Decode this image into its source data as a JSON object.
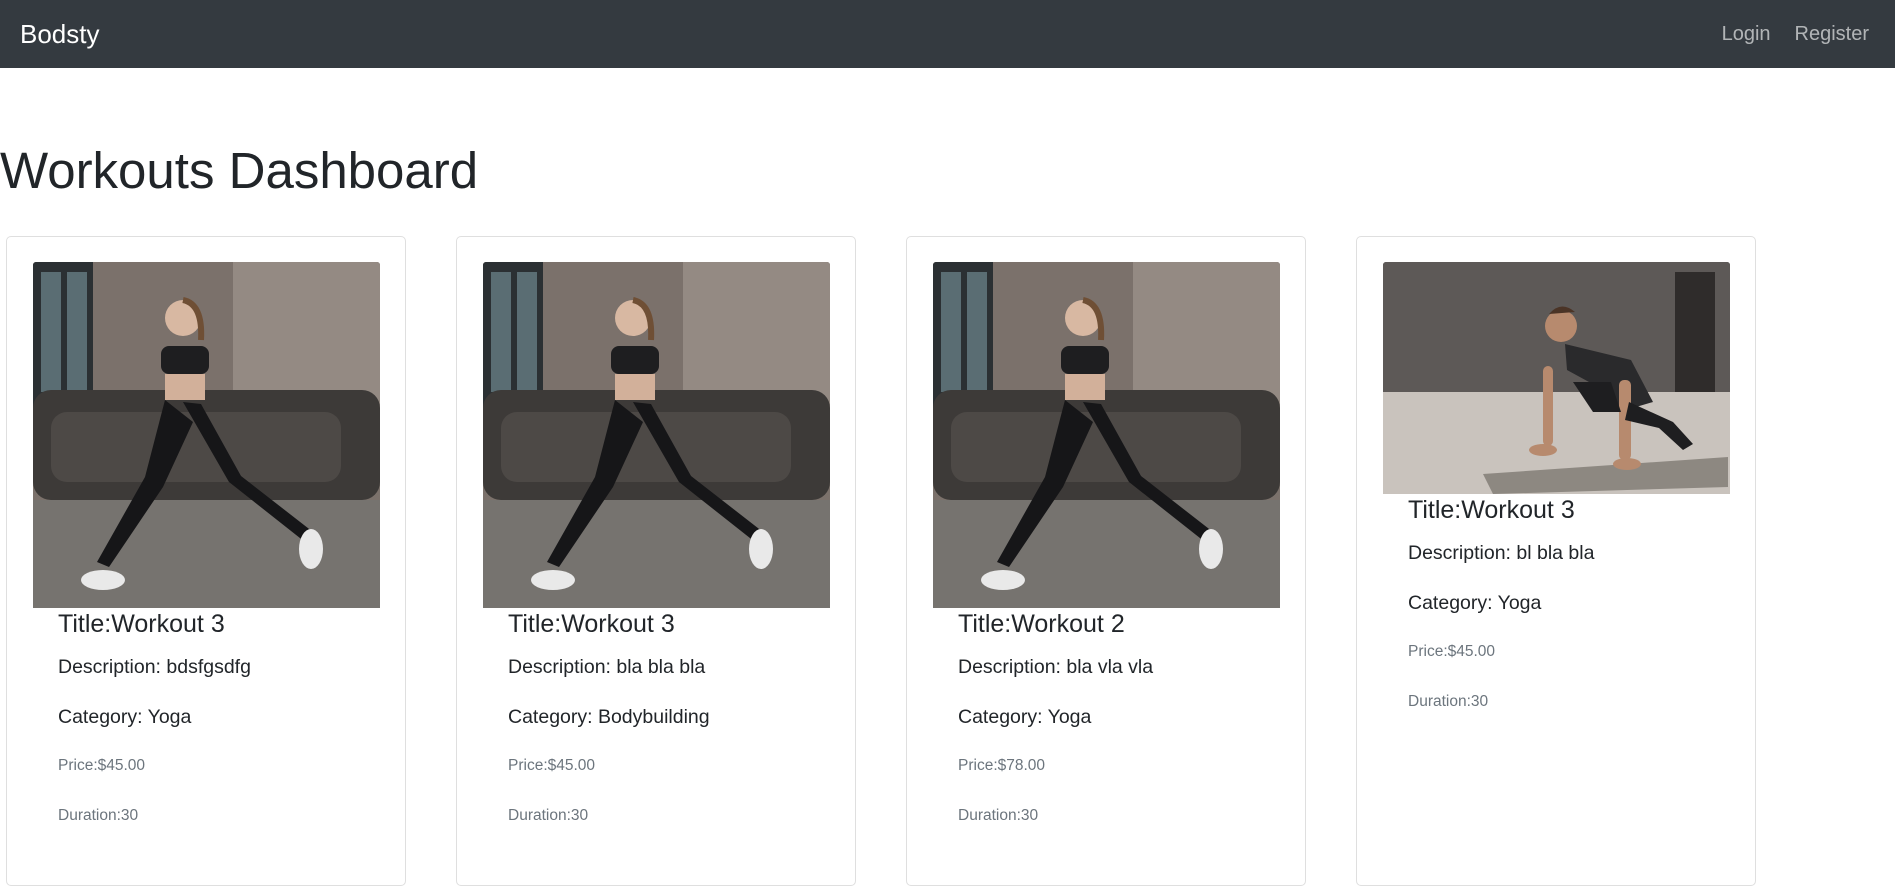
{
  "navbar": {
    "brand": "Bodsty",
    "links": [
      "Login",
      "Register"
    ]
  },
  "page": {
    "title": "Workouts Dashboard"
  },
  "cards": [
    {
      "image": "woman-lunge-photo",
      "title": "Title:Workout 3",
      "description": "Description: bdsfgsdfg",
      "category": "Category: Yoga",
      "price": "Price:$45.00",
      "duration": "Duration:30"
    },
    {
      "image": "woman-lunge-photo",
      "title": "Title:Workout 3",
      "description": "Description: bla bla bla",
      "category": "Category: Bodybuilding",
      "price": "Price:$45.00",
      "duration": "Duration:30"
    },
    {
      "image": "woman-lunge-photo",
      "title": "Title:Workout 2",
      "description": "Description: bla vla vla",
      "category": "Category: Yoga",
      "price": "Price:$78.00",
      "duration": "Duration:30"
    },
    {
      "image": "man-mountain-climber-photo",
      "title": "Title:Workout 3",
      "description": "Description: bl bla bla",
      "category": "Category: Yoga",
      "price": "Price:$45.00",
      "duration": "Duration:30"
    }
  ],
  "colors": {
    "navbar_bg": "#343a40",
    "brand_text": "#ffffff",
    "nav_link_text": "#a6a9ac",
    "muted_text": "#6c757d",
    "card_border": "#dfdfdf"
  }
}
